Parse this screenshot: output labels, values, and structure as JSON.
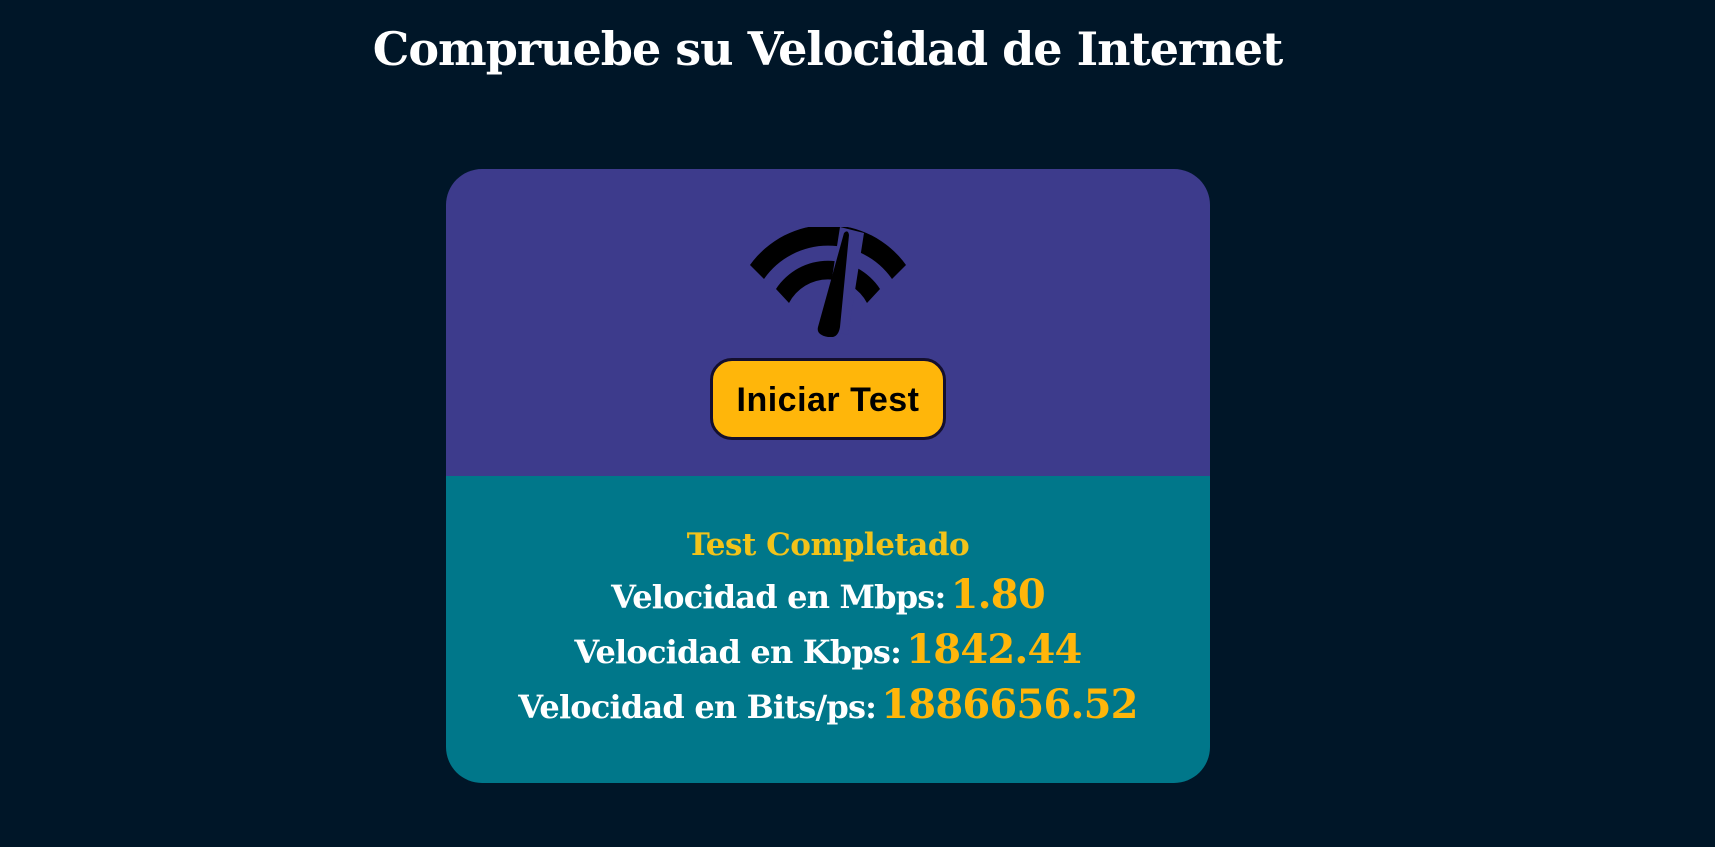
{
  "page": {
    "title": "Compruebe su Velocidad de Internet"
  },
  "card": {
    "top": {
      "icon": "speedometer-gauge-icon",
      "start_button_label": "Iniciar Test"
    },
    "results": {
      "status": "Test Completado",
      "mbps_label": "Velocidad en Mbps:",
      "mbps_value": "1.80",
      "kbps_label": "Velocidad en Kbps:",
      "kbps_value": "1842.44",
      "bits_label": "Velocidad en Bits/ps:",
      "bits_value": "1886656.52"
    }
  },
  "colors": {
    "page_background": "#001628",
    "card_top_background": "#3d3b8c",
    "card_bottom_background": "#00778a",
    "button_background": "#ffb60a",
    "status_text": "#f2c31a",
    "value_text": "#ffb60a",
    "label_text": "#ffffff"
  }
}
